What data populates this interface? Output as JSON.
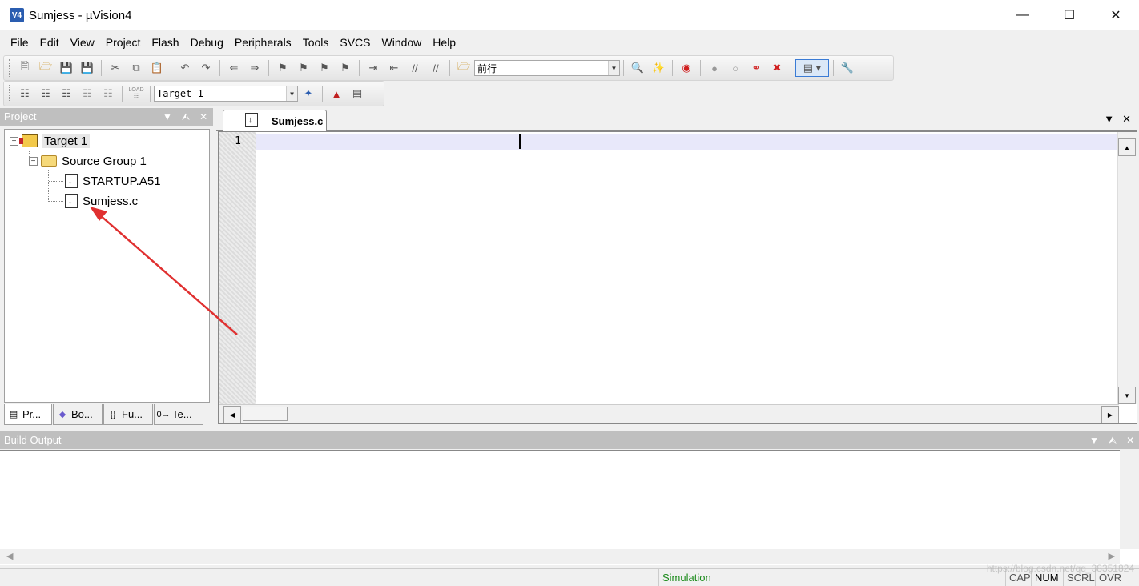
{
  "window": {
    "title": "Sumjess  - µVision4",
    "app_icon": "V4"
  },
  "menu": [
    "File",
    "Edit",
    "View",
    "Project",
    "Flash",
    "Debug",
    "Peripherals",
    "Tools",
    "SVCS",
    "Window",
    "Help"
  ],
  "toolbar1": {
    "find_combo_value": "前行"
  },
  "toolbar2": {
    "load_label": "LOAD",
    "target_combo_value": "Target 1"
  },
  "project_panel": {
    "title": "Project",
    "tree": {
      "target": "Target 1",
      "group": "Source Group 1",
      "files": [
        "STARTUP.A51",
        "Sumjess.c"
      ]
    },
    "tabs": [
      "Pr...",
      "Bo...",
      "Fu...",
      "Te..."
    ],
    "tab_icons": [
      "project-icon",
      "books-icon",
      "functions-icon",
      "templates-icon"
    ]
  },
  "editor": {
    "tab_label": "Sumjess.c",
    "line_number": "1"
  },
  "build_output": {
    "title": "Build Output"
  },
  "status": {
    "mode": "Simulation",
    "cap": "CAP",
    "num": "NUM",
    "scrl": "SCRL",
    "ovr": "OVR",
    "watermark": "https://blog.csdn.net/qq_38351824"
  },
  "colors": {
    "panel_header": "#bfbfbf",
    "current_line": "#e8e8fa",
    "simulation_text": "#1a8a1a",
    "annotation_arrow": "#e03030"
  }
}
